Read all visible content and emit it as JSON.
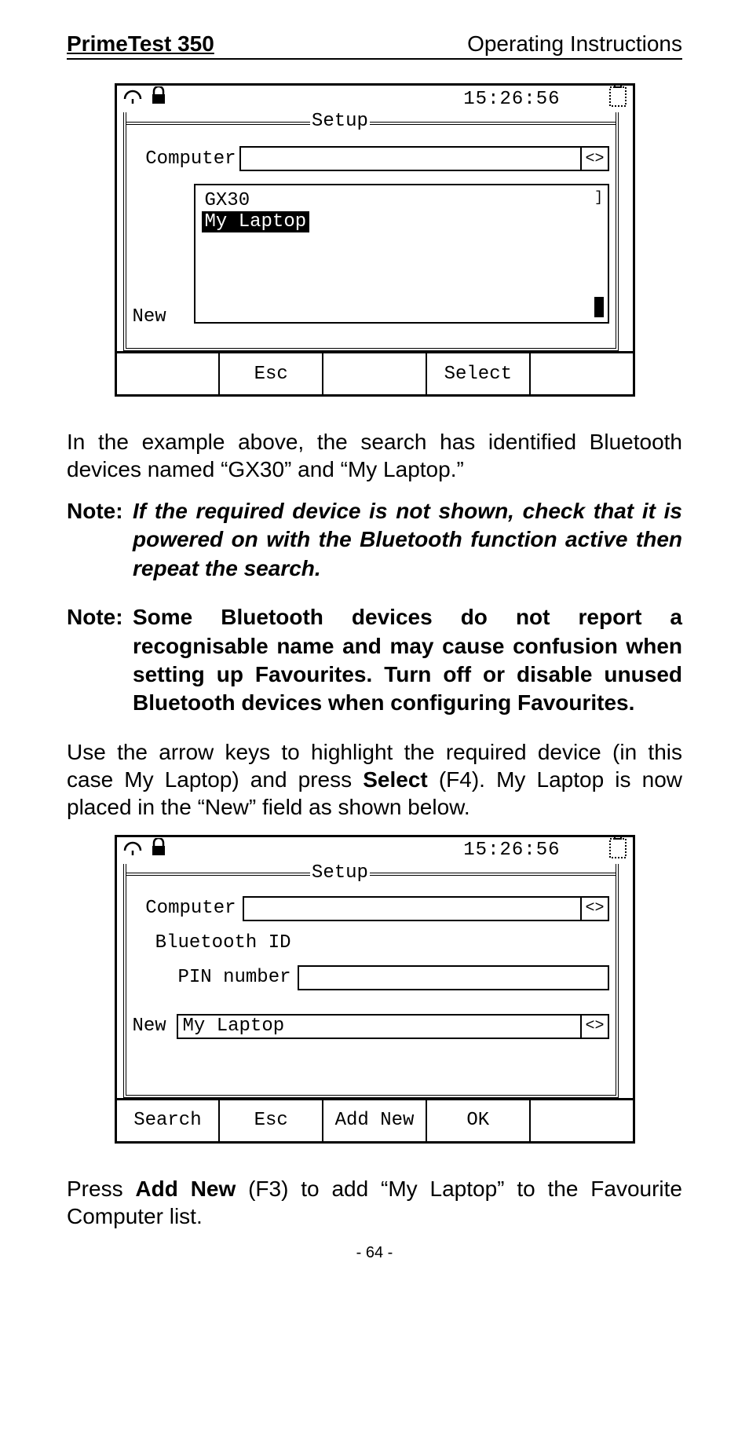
{
  "header": {
    "left": "PrimeTest 350",
    "right": "Operating Instructions"
  },
  "screen1": {
    "time": "15:26:56",
    "frame_title": "Setup",
    "computer_label": "Computer",
    "computer_value": "",
    "arrows": "<>",
    "list": {
      "items": [
        "GX30",
        "My Laptop"
      ],
      "selected_index": 1
    },
    "new_label": "New",
    "softkeys": [
      "",
      "Esc",
      "",
      "Select",
      ""
    ]
  },
  "para1": "In the example above, the search has identified Bluetooth devices named “GX30” and “My Laptop.”",
  "note1": {
    "label": "Note:",
    "body": "If the required device is not shown, check that it is powered on with the Bluetooth function active then repeat the search."
  },
  "note2": {
    "label": "Note:",
    "body": "Some Bluetooth devices do not report a recognisable name and may cause confusion when setting up Favourites. Turn off or disable unused Bluetooth devices when configuring Favourites."
  },
  "para2_pre": "Use the arrow keys to highlight the required device (in this case My Laptop) and press ",
  "para2_bold": "Select",
  "para2_post": " (F4). My Laptop is now placed in the “New” field as shown below.",
  "screen2": {
    "time": "15:26:56",
    "frame_title": "Setup",
    "computer_label": "Computer",
    "computer_value": "",
    "arrows": "<>",
    "bt_label": "Bluetooth ID",
    "bt_value": "",
    "pin_label": "PIN number",
    "pin_value": "",
    "new_label": "New",
    "new_value": "My Laptop",
    "softkeys": [
      "Search",
      "Esc",
      "Add New",
      "OK",
      ""
    ]
  },
  "para3_pre": "Press ",
  "para3_bold": "Add New",
  "para3_post": " (F3) to add “My Laptop” to the Favourite Computer list.",
  "page_number": "- 64 -"
}
